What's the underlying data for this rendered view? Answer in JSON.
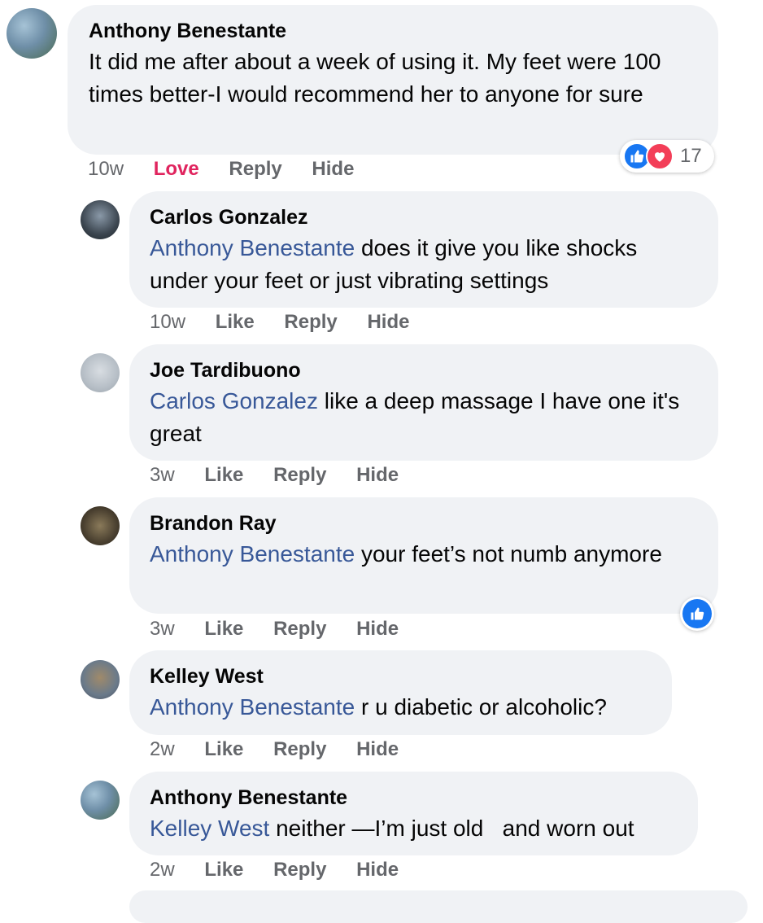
{
  "comments": [
    {
      "author": "Anthony Benestante",
      "mention": "",
      "text": "It did me after about a week of using it. My feet were 100 times better-I would recommend her to anyone for sure",
      "time": "10w",
      "react_label": "Love",
      "reply_label": "Reply",
      "hide_label": "Hide",
      "reactions": {
        "count": "17",
        "icons": [
          "like-icon",
          "love-icon"
        ]
      }
    },
    {
      "author": "Carlos Gonzalez",
      "mention": "Anthony Benestante",
      "text": " does it give you like shocks under your feet or just vibrating settings",
      "time": "10w",
      "react_label": "Like",
      "reply_label": "Reply",
      "hide_label": "Hide"
    },
    {
      "author": "Joe Tardibuono",
      "mention": "Carlos Gonzalez",
      "text": " like a deep massage I have one it's great",
      "time": "3w",
      "react_label": "Like",
      "reply_label": "Reply",
      "hide_label": "Hide"
    },
    {
      "author": "Brandon Ray",
      "mention": "Anthony Benestante",
      "text": " your feet’s not numb anymore",
      "time": "3w",
      "react_label": "Like",
      "reply_label": "Reply",
      "hide_label": "Hide",
      "reaction_badge": "like-icon"
    },
    {
      "author": "Kelley West",
      "mention": "Anthony Benestante",
      "text": " r u diabetic or alcoholic?",
      "time": "2w",
      "react_label": "Like",
      "reply_label": "Reply",
      "hide_label": "Hide"
    },
    {
      "author": "Anthony Benestante",
      "mention": "Kelley West",
      "text": " neither —I’m just old   and worn out",
      "time": "2w",
      "react_label": "Like",
      "reply_label": "Reply",
      "hide_label": "Hide"
    }
  ],
  "colors": {
    "bubble": "#f0f2f5",
    "mention": "#385898",
    "love": "#e0245e",
    "like_blue": "#1877f2",
    "love_red": "#f33e58",
    "meta": "#65676b"
  }
}
